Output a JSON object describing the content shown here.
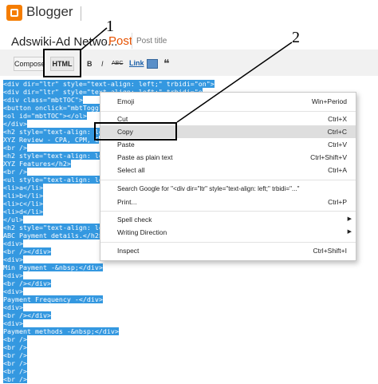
{
  "header": {
    "brand": "Blogger",
    "blog_name": "Adswiki-Ad Netwo...",
    "separator": "·",
    "post_label": "Post",
    "post_title_placeholder": "Post title"
  },
  "toolbar": {
    "compose": "Compose",
    "html": "HTML",
    "bold": "B",
    "italic": "I",
    "strikethrough": "ABC",
    "link": "Link",
    "quote": "❝"
  },
  "callouts": {
    "one": "1",
    "two": "2"
  },
  "code": [
    "<div dir=\"ltr\" style=\"text-align: left;\" trbidi=\"on\">",
    "<div dir=\"ltr\" style=\"text-align: left;\" trbidi=\"o",
    "<div class=\"mbtTOC\">",
    "<button onclick=\"mbtToggle",
    "<ol id=\"mbtTOC\"></ol>",
    "</div>",
    "<h2 style=\"text-align: le",
    "XYZ Review - CPA, CPM, C",
    "<br />",
    "<h2 style=\"text-align: lef",
    "XYZ Features</h2>",
    "<br />",
    "<ul style=\"text-align: lef",
    "<li>a</li>",
    "<li>b</li>",
    "<li>c</li>",
    "<li>d</li>",
    "</ul>",
    "<h2 style=\"text-align: lef",
    "ABC Payment details.</h2>",
    "<div>",
    "<br /></div>",
    "<div>",
    "Min Payment -&nbsp;</div>",
    "<div>",
    "<br /></div>",
    "<div>",
    "Payment Frequency -</div>",
    "<div>",
    "<br /></div>",
    "<div>",
    "Payment methods -&nbsp;</div>",
    "<br />",
    "<br />",
    "<br />",
    "<br />",
    "<br />",
    "<br />"
  ],
  "context_menu": {
    "emoji": {
      "label": "Emoji",
      "shortcut": "Win+Period"
    },
    "cut": {
      "label": "Cut",
      "shortcut": "Ctrl+X"
    },
    "copy": {
      "label": "Copy",
      "shortcut": "Ctrl+C"
    },
    "paste": {
      "label": "Paste",
      "shortcut": "Ctrl+V"
    },
    "paste_plain": {
      "label": "Paste as plain text",
      "shortcut": "Ctrl+Shift+V"
    },
    "select_all": {
      "label": "Select all",
      "shortcut": "Ctrl+A"
    },
    "search": {
      "label": "Search Google for \"<div dir=\"ltr\" style=\"text-align: left;\" trbidi=\"...\""
    },
    "print": {
      "label": "Print...",
      "shortcut": "Ctrl+P"
    },
    "spell_check": {
      "label": "Spell check",
      "arrow": "▶"
    },
    "writing_direction": {
      "label": "Writing Direction",
      "arrow": "▶"
    },
    "inspect": {
      "label": "Inspect",
      "shortcut": "Ctrl+Shift+I"
    }
  },
  "colors": {
    "selection": "#3498e0",
    "brand_orange": "#f57d00",
    "post_orange": "#e65100"
  }
}
